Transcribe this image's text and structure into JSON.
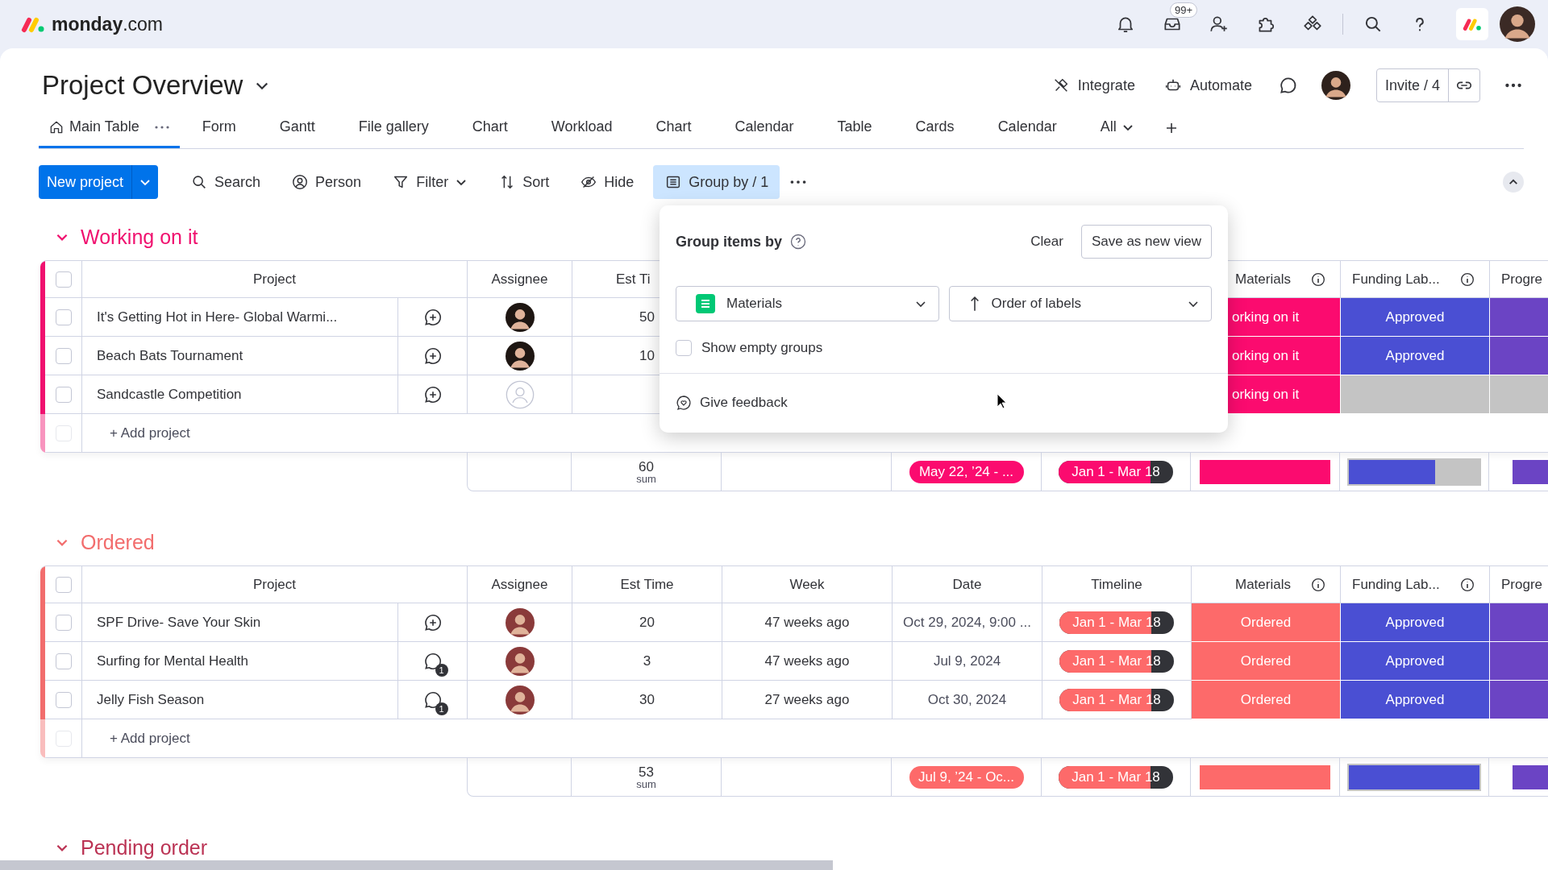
{
  "top_bar": {
    "brand": "**monday**.com",
    "inbox_badge": "99+"
  },
  "board": {
    "title": "Project Overview",
    "actions": [
      {
        "label": "Integrate",
        "kind": "integrate"
      },
      {
        "label": "Automate",
        "kind": "automate"
      }
    ],
    "invite": "Invite / 4"
  },
  "tabs": [
    {
      "label": "Main Table",
      "selected": true
    },
    {
      "label": "Form",
      "selected": false
    },
    {
      "label": "Gantt",
      "selected": false
    },
    {
      "label": "File gallery",
      "selected": false
    },
    {
      "label": "Chart",
      "selected": false
    },
    {
      "label": "Workload",
      "selected": false
    },
    {
      "label": "Chart",
      "selected": false
    },
    {
      "label": "Calendar",
      "selected": false
    },
    {
      "label": "Table",
      "selected": false
    },
    {
      "label": "Cards",
      "selected": false
    },
    {
      "label": "Calendar",
      "selected": false
    }
  ],
  "more_views": "All",
  "toolbar": {
    "primary": "New project",
    "items": [
      {
        "label": "Search",
        "kind": "search",
        "selected": false
      },
      {
        "label": "Person",
        "kind": "person",
        "selected": false
      },
      {
        "label": "Filter",
        "kind": "filter",
        "selected": false
      },
      {
        "label": "Sort",
        "kind": "sort",
        "selected": false
      },
      {
        "label": "Hide",
        "kind": "hide",
        "selected": false
      },
      {
        "label": "Group by / 1",
        "kind": "group",
        "selected": true
      }
    ]
  },
  "popover": {
    "title": "Group items by",
    "clear": "Clear",
    "save": "Save as new view",
    "group_field": "Materials",
    "order": "Order of labels",
    "show_empty": {
      "label": "Show empty groups",
      "checked": false
    },
    "feedback": "Give feedback"
  },
  "groups": [
    {
      "title": "Working on it",
      "color": "#f0116f",
      "select_all_checked": false,
      "columns": {
        "project": "Project",
        "assignee": "Assignee",
        "est_time": "Est Ti",
        "materials": "Materials",
        "funding": "Funding Lab...",
        "progress": "Progre"
      },
      "rows": [
        {
          "checked": false,
          "project": "It's Getting Hot in Here- Global Warmi...",
          "updates": {
            "kind": "add"
          },
          "assignee": {
            "kind": "photo"
          },
          "est_time": "50",
          "materials": {
            "label": "orking on it",
            "color": "#fb0b6f"
          },
          "funding": {
            "label": "Approved",
            "color": "#4a4fd3"
          },
          "progress": {
            "color": "#6b44c4"
          }
        },
        {
          "checked": false,
          "project": "Beach Bats Tournament",
          "updates": {
            "kind": "add"
          },
          "assignee": {
            "kind": "photo"
          },
          "est_time": "10",
          "materials": {
            "label": "orking on it",
            "color": "#fb0b6f"
          },
          "funding": {
            "label": "Approved",
            "color": "#4a4fd3"
          },
          "progress": {
            "color": "#6b44c4"
          }
        },
        {
          "checked": false,
          "project": "Sandcastle Competition",
          "updates": {
            "kind": "add"
          },
          "assignee": {
            "kind": "empty"
          },
          "materials": {
            "label": "orking on it",
            "color": "#fb0b6f"
          },
          "funding": {
            "color": "#c4c4c4"
          },
          "progress": {
            "color": "#c4c4c4"
          }
        }
      ],
      "add_row": "+ Add project",
      "add_row_checked": false,
      "summary": {
        "est_time": "60",
        "est_time_label": "sum",
        "date": {
          "label": "May 22, ’24 - ...",
          "color": "#fb0b6f"
        },
        "timeline": {
          "label": "Jan 1 - Mar 18",
          "color": "#fb0b6f",
          "level": 0.8
        },
        "materials": {
          "color": "#fb0b6f"
        },
        "funding": {
          "color": "#4a4fd3",
          "level": 0.66
        },
        "progress": {
          "color": "#6b44c4"
        }
      }
    },
    {
      "title": "Ordered",
      "color": "#f26d6d",
      "select_all_checked": false,
      "columns": {
        "project": "Project",
        "assignee": "Assignee",
        "est_time": "Est Time",
        "week": "Week",
        "date": "Date",
        "timeline": "Timeline",
        "materials": "Materials",
        "funding": "Funding Lab...",
        "progress": "Progre"
      },
      "rows": [
        {
          "checked": false,
          "project": "SPF Drive- Save Your Skin",
          "updates": {
            "kind": "add"
          },
          "assignee": {
            "kind": "photo"
          },
          "est_time": "20",
          "week": "47 weeks ago",
          "date": "Oct 29, 2024, 9:00 ...",
          "timeline": {
            "label": "Jan 1 - Mar 18",
            "color": "#fd6a6a",
            "level": 0.8
          },
          "materials": {
            "label": "Ordered",
            "color": "#fd6a6a"
          },
          "funding": {
            "label": "Approved",
            "color": "#4a4fd3"
          },
          "progress": {
            "color": "#6b44c4"
          }
        },
        {
          "checked": false,
          "project": "Surfing for Mental Health",
          "updates": {
            "kind": "count",
            "count": "1"
          },
          "assignee": {
            "kind": "photo"
          },
          "est_time": "3",
          "week": "47 weeks ago",
          "date": "Jul 9, 2024",
          "timeline": {
            "label": "Jan 1 - Mar 18",
            "color": "#fd6a6a",
            "level": 0.8
          },
          "materials": {
            "label": "Ordered",
            "color": "#fd6a6a"
          },
          "funding": {
            "label": "Approved",
            "color": "#4a4fd3"
          },
          "progress": {
            "color": "#6b44c4"
          }
        },
        {
          "checked": false,
          "project": "Jelly Fish Season",
          "updates": {
            "kind": "count",
            "count": "1"
          },
          "assignee": {
            "kind": "photo"
          },
          "est_time": "30",
          "week": "27 weeks ago",
          "date": "Oct 30, 2024",
          "timeline": {
            "label": "Jan 1 - Mar 18",
            "color": "#fd6a6a",
            "level": 0.8
          },
          "materials": {
            "label": "Ordered",
            "color": "#fd6a6a"
          },
          "funding": {
            "label": "Approved",
            "color": "#4a4fd3"
          },
          "progress": {
            "color": "#6b44c4"
          }
        }
      ],
      "add_row": "+ Add project",
      "add_row_checked": false,
      "summary": {
        "est_time": "53",
        "est_time_label": "sum",
        "date": {
          "label": "Jul 9, ’24 - Oc...",
          "color": "#fd6a6a"
        },
        "timeline": {
          "label": "Jan 1 - Mar 18",
          "color": "#fd6a6a",
          "level": 0.8
        },
        "materials": {
          "color": "#fd6a6a"
        },
        "funding": {
          "color": "#4a4fd3",
          "level": 1
        },
        "progress": {
          "color": "#6b44c4"
        }
      }
    },
    {
      "title": "Pending order",
      "color": "#bb3354"
    }
  ]
}
